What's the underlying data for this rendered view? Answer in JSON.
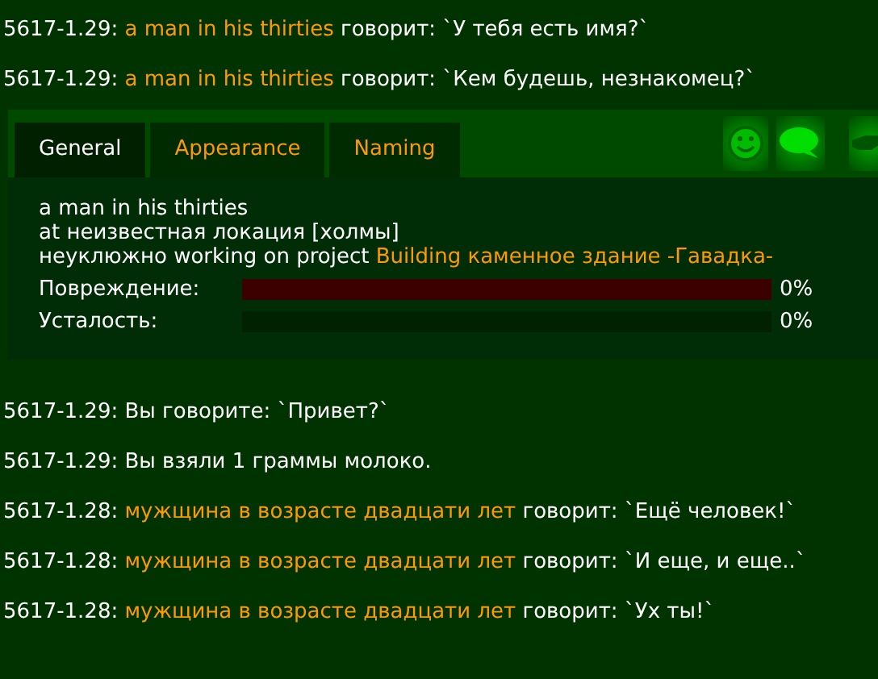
{
  "messages_top": [
    {
      "time": "5617-1.29:",
      "speaker": "a man in his thirties",
      "text": "говорит: `У тебя есть имя?`"
    },
    {
      "time": "5617-1.29:",
      "speaker": "a man in his thirties",
      "text": "говорит: `Кем будешь, незнакомец?`"
    }
  ],
  "panel": {
    "tabs": [
      {
        "label": "General",
        "selected": true
      },
      {
        "label": "Appearance",
        "selected": false
      },
      {
        "label": "Naming",
        "selected": false
      }
    ],
    "info": {
      "name": "a man in his thirties",
      "location": "at неизвестная локация [холмы]",
      "activity": "неуклюжно working on project",
      "project": "Building каменное здание -Гавадка-"
    },
    "bars": [
      {
        "label": "Повреждение:",
        "color": "#3d0000",
        "level": 0,
        "reading": "0%"
      },
      {
        "label": "Усталость:",
        "color": "#002200",
        "level": 0,
        "reading": "0%"
      }
    ]
  },
  "messages_bottom": [
    {
      "time": "5617-1.29:",
      "text": "Вы говорите: `Привет?`"
    },
    {
      "time": "5617-1.29:",
      "text": "Вы взяли 1 граммы молоко."
    },
    {
      "time": "5617-1.28:",
      "speaker": "мужщина в возрасте двадцати лет",
      "text": "говорит: `Ещё человек!`"
    },
    {
      "time": "5617-1.28:",
      "speaker": "мужщина в возрасте двадцати лет",
      "text": "говорит: `И еще, и еще..`"
    },
    {
      "time": "5617-1.28:",
      "speaker": "мужщина в возрасте двадцати лет",
      "text": "говорит: `Ух ты!`"
    }
  ]
}
